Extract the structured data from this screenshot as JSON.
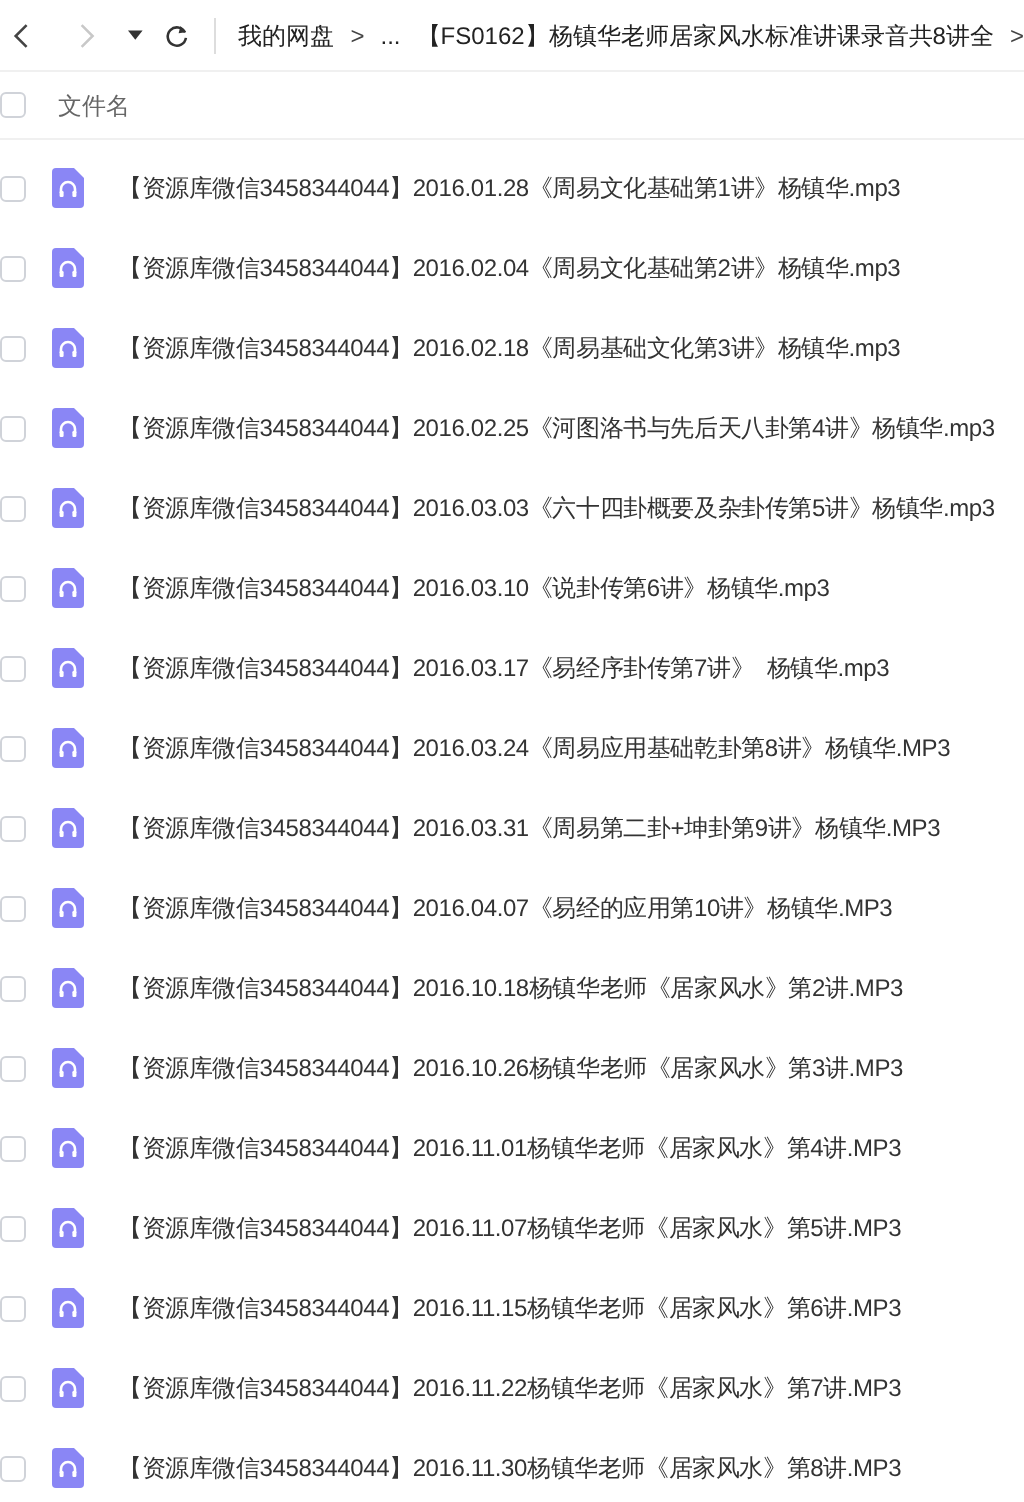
{
  "toolbar": {
    "back": {
      "disabled": false
    },
    "forward": {
      "disabled": true
    },
    "breadcrumb": [
      {
        "kind": "link",
        "label": "我的网盘"
      },
      {
        "kind": "sep",
        "label": ">"
      },
      {
        "kind": "link",
        "label": "..."
      },
      {
        "kind": "link",
        "label": "【FS0162】杨镇华老师居家风水标准讲课录音共8讲全"
      },
      {
        "kind": "sep",
        "label": ">"
      }
    ]
  },
  "header": {
    "checked": false,
    "label": "文件名"
  },
  "files": [
    {
      "checked": false,
      "name": "【资源库微信3458344044】2016.01.28《周易文化基础第1讲》杨镇华.mp3"
    },
    {
      "checked": false,
      "name": "【资源库微信3458344044】2016.02.04《周易文化基础第2讲》杨镇华.mp3"
    },
    {
      "checked": false,
      "name": "【资源库微信3458344044】2016.02.18《周易基础文化第3讲》杨镇华.mp3"
    },
    {
      "checked": false,
      "name": "【资源库微信3458344044】2016.02.25《河图洛书与先后天八卦第4讲》杨镇华.mp3"
    },
    {
      "checked": false,
      "name": "【资源库微信3458344044】2016.03.03《六十四卦概要及杂卦传第5讲》杨镇华.mp3"
    },
    {
      "checked": false,
      "name": "【资源库微信3458344044】2016.03.10《说卦传第6讲》杨镇华.mp3"
    },
    {
      "checked": false,
      "name": "【资源库微信3458344044】2016.03.17《易经序卦传第7讲》  杨镇华.mp3"
    },
    {
      "checked": false,
      "name": "【资源库微信3458344044】2016.03.24《周易应用基础乾卦第8讲》杨镇华.MP3"
    },
    {
      "checked": false,
      "name": "【资源库微信3458344044】2016.03.31《周易第二卦+坤卦第9讲》杨镇华.MP3"
    },
    {
      "checked": false,
      "name": "【资源库微信3458344044】2016.04.07《易经的应用第10讲》杨镇华.MP3"
    },
    {
      "checked": false,
      "name": "【资源库微信3458344044】2016.10.18杨镇华老师《居家风水》第2讲.MP3"
    },
    {
      "checked": false,
      "name": "【资源库微信3458344044】2016.10.26杨镇华老师《居家风水》第3讲.MP3"
    },
    {
      "checked": false,
      "name": "【资源库微信3458344044】2016.11.01杨镇华老师《居家风水》第4讲.MP3"
    },
    {
      "checked": false,
      "name": "【资源库微信3458344044】2016.11.07杨镇华老师《居家风水》第5讲.MP3"
    },
    {
      "checked": false,
      "name": "【资源库微信3458344044】2016.11.15杨镇华老师《居家风水》第6讲.MP3"
    },
    {
      "checked": false,
      "name": "【资源库微信3458344044】2016.11.22杨镇华老师《居家风水》第7讲.MP3"
    },
    {
      "checked": false,
      "name": "【资源库微信3458344044】2016.11.30杨镇华老师《居家风水》第8讲.MP3"
    }
  ]
}
